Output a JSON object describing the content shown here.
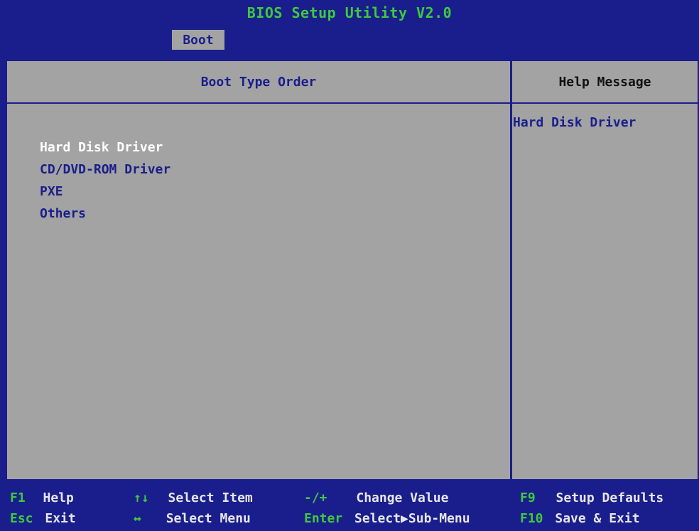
{
  "header": {
    "title": "BIOS Setup Utility V2.0",
    "tabs": [
      {
        "label": "Boot"
      }
    ]
  },
  "main": {
    "left_title": "Boot Type Order",
    "right_title": "Help Message",
    "boot_items": [
      {
        "label": "Hard Disk Driver"
      },
      {
        "label": "CD/DVD-ROM Driver"
      },
      {
        "label": "PXE"
      },
      {
        "label": "Others"
      }
    ],
    "selected_index": 0,
    "help_text": "Hard Disk Driver"
  },
  "footer": {
    "keys": [
      {
        "key": "F1",
        "desc": "Help"
      },
      {
        "key": "Esc",
        "desc": "Exit"
      },
      {
        "key": "↑↓",
        "desc": "Select Item"
      },
      {
        "key": "↔",
        "desc": "Select Menu"
      },
      {
        "key": "-/+",
        "desc": "Change Value"
      },
      {
        "key": "Enter",
        "desc": "Select▶Sub-Menu"
      },
      {
        "key": "F9",
        "desc": "Setup Defaults"
      },
      {
        "key": "F10",
        "desc": "Save & Exit"
      }
    ]
  },
  "colors": {
    "background_blue": "#1a1e8c",
    "panel_gray": "#a3a3a3",
    "key_green": "#3ec93e",
    "selected_text": "#ffffff"
  }
}
